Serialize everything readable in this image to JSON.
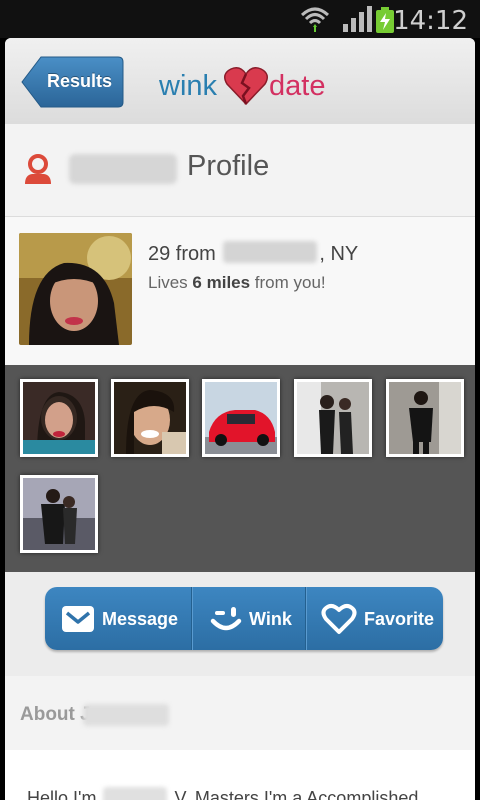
{
  "status_bar": {
    "time": "14:12"
  },
  "header": {
    "back_label": "Results",
    "logo_left": "wink",
    "logo_right": "date"
  },
  "profile": {
    "title": "Profile",
    "age_text": "29 from",
    "state": ", NY",
    "distance_prefix": "Lives ",
    "distance_value": "6 miles",
    "distance_suffix": " from you!"
  },
  "actions": {
    "message": "Message",
    "wink": "Wink",
    "favorite": "Favorite"
  },
  "about": {
    "label": "About J"
  },
  "bio": {
    "prefix": "Hello I'm",
    "suffix": "V. Masters I'm a Accomplished,"
  },
  "colors": {
    "accent_blue": "#3077b3",
    "brand_red": "#d33061",
    "gallery_bg": "#555555"
  },
  "gallery": {
    "photos": [
      {
        "subject": "woman portrait red lips"
      },
      {
        "subject": "woman smiling"
      },
      {
        "subject": "red sports car"
      },
      {
        "subject": "two people dancing"
      },
      {
        "subject": "person in black outfit"
      },
      {
        "subject": "two people posing"
      }
    ]
  }
}
